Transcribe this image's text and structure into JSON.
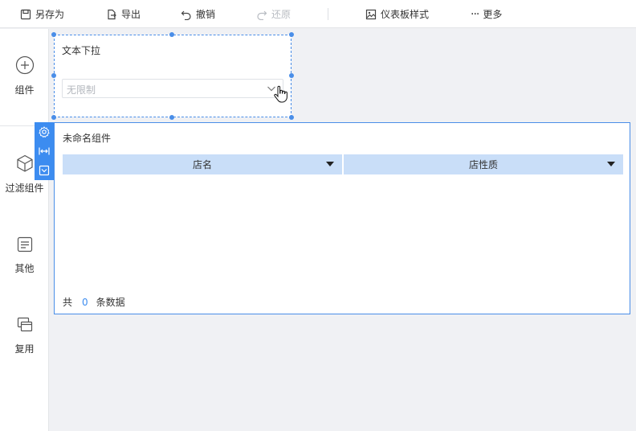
{
  "toolbar": {
    "save_as": "另存为",
    "export": "导出",
    "undo": "撤销",
    "redo": "还原",
    "dashboard_style": "仪表板样式",
    "more": "更多"
  },
  "sidebar": {
    "items": [
      {
        "label": "组件",
        "icon": "plus-circle-icon"
      },
      {
        "label": "过滤组件",
        "icon": "cube-icon"
      },
      {
        "label": "其他",
        "icon": "document-icon"
      },
      {
        "label": "复用",
        "icon": "stacked-windows-icon"
      }
    ]
  },
  "filter_widget": {
    "title": "文本下拉",
    "placeholder": "无限制"
  },
  "table_widget": {
    "title": "未命名组件",
    "columns": [
      "店名",
      "店性质"
    ],
    "footer_prefix": "共",
    "count": "0",
    "footer_suffix": "条数据"
  },
  "colors": {
    "accent": "#3c8cf0",
    "header_bg": "#c9def8",
    "canvas_bg": "#f0f1f4"
  }
}
